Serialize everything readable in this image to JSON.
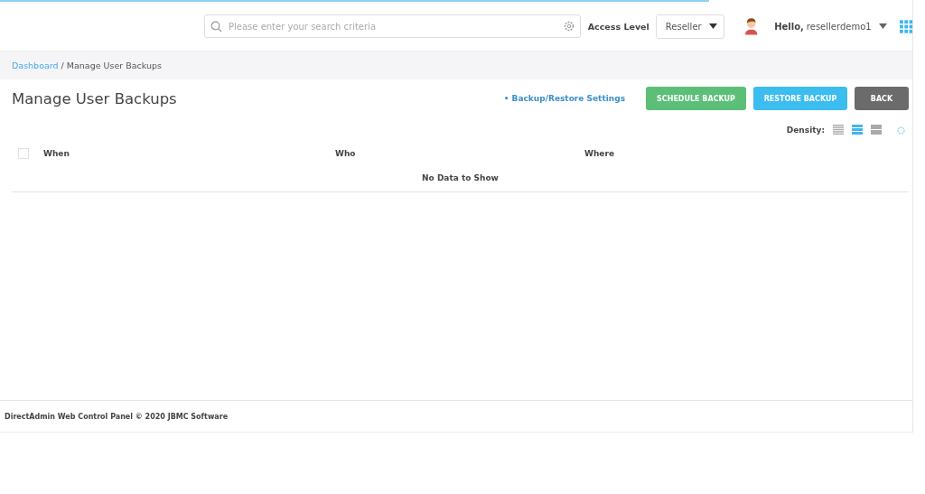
{
  "loading_bar": {
    "level": 0.777
  },
  "header": {
    "search": {
      "placeholder": "Please enter your search criteria"
    },
    "access_level": {
      "label": "Access Level",
      "value": "Reseller"
    },
    "user": {
      "greeting": "Hello,",
      "name": "resellerdemo1"
    }
  },
  "breadcrumb": [
    {
      "label": "Dashboard",
      "link": true
    },
    {
      "label": "/ Manage User Backups",
      "link": false
    }
  ],
  "page_title": "Manage User Backups",
  "actions": {
    "link": "• Backup/Restore Settings",
    "buttons": [
      {
        "label": "SCHEDULE BACKUP",
        "kind": "success"
      },
      {
        "label": "RESTORE BACKUP",
        "kind": "info"
      },
      {
        "label": "BACK",
        "kind": "dark"
      }
    ]
  },
  "density": {
    "label": "Density:",
    "options": [
      {
        "kind": "compact",
        "selected": false
      },
      {
        "kind": "normal",
        "selected": true
      },
      {
        "kind": "wide",
        "selected": false
      }
    ]
  },
  "table": {
    "select_all": {
      "checked": false
    },
    "columns": [
      "When",
      "Who",
      "Where"
    ],
    "empty_message": "No Data to Show"
  },
  "footer": "DirectAdmin Web Control Panel © 2020 JBMC Software"
}
